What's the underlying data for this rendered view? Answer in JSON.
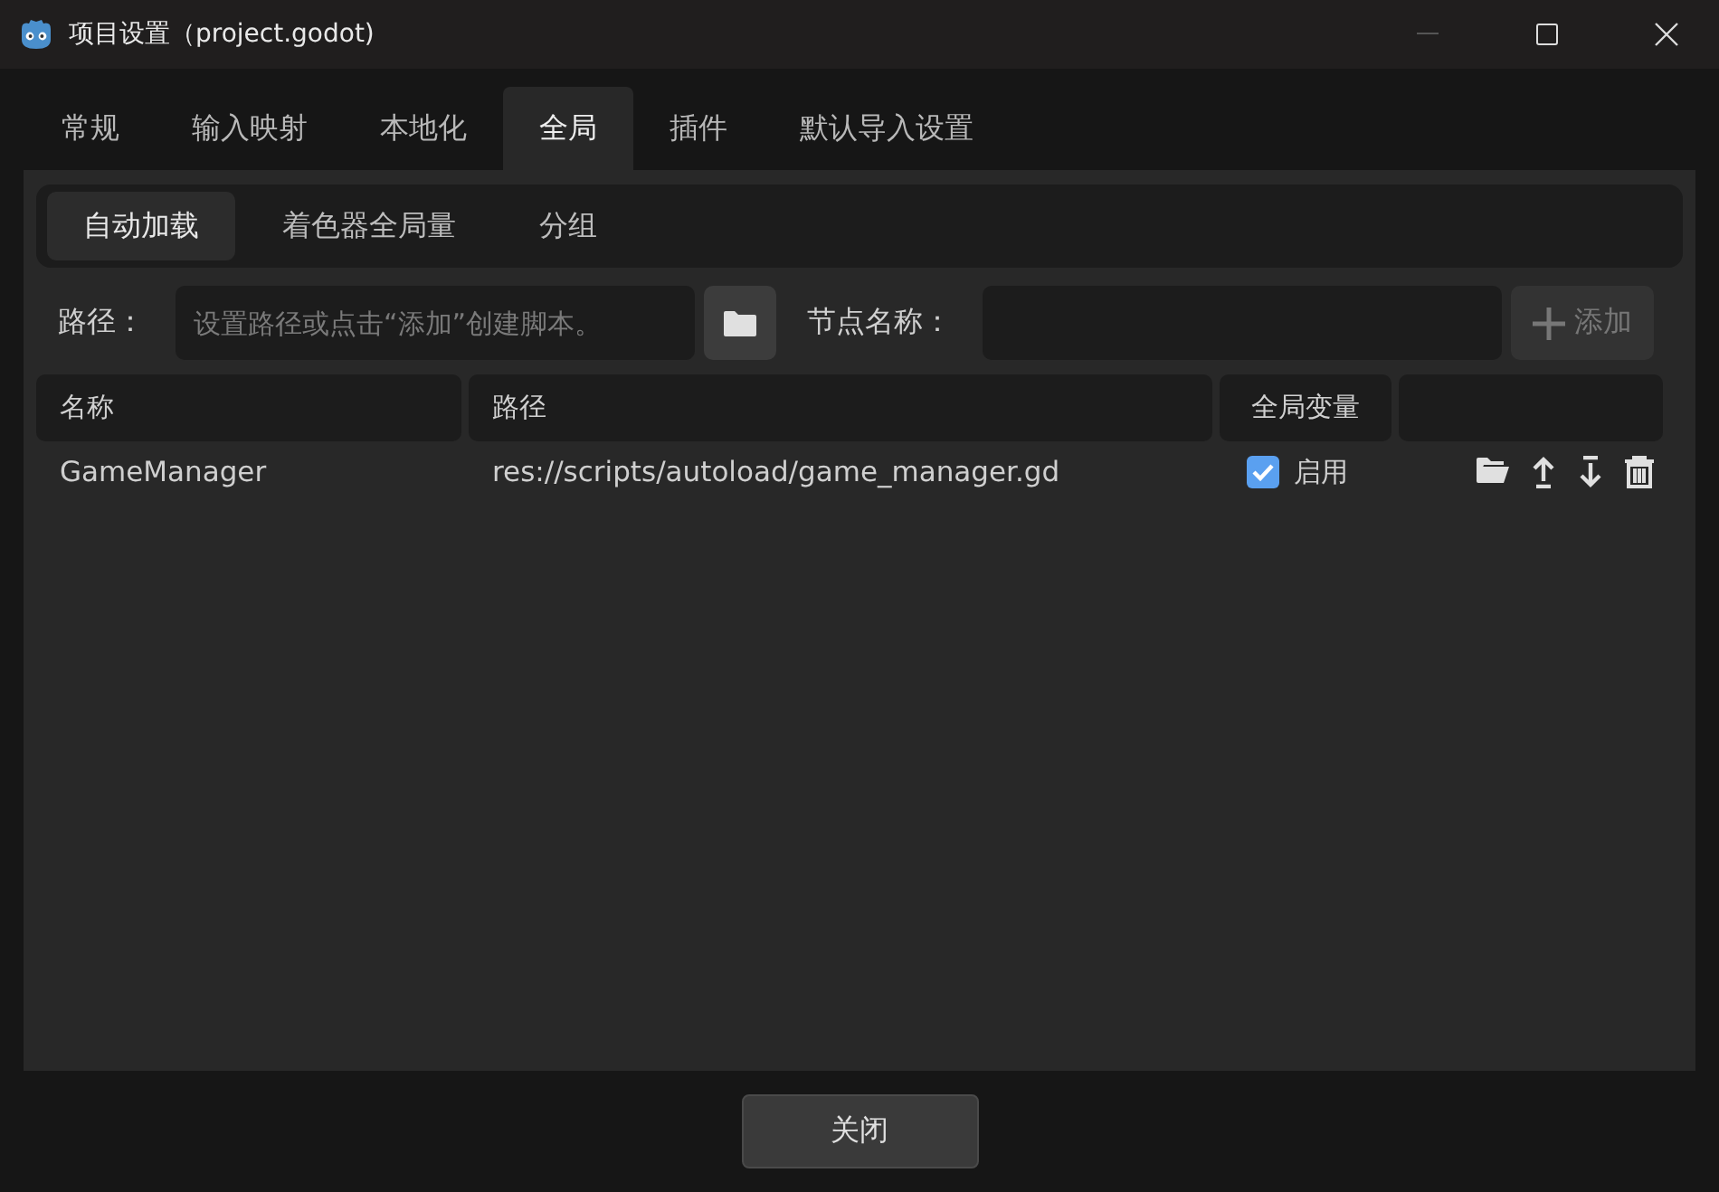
{
  "window": {
    "title": "项目设置（project.godot)"
  },
  "tabs": [
    {
      "label": "常规",
      "selected": false
    },
    {
      "label": "输入映射",
      "selected": false
    },
    {
      "label": "本地化",
      "selected": false
    },
    {
      "label": "全局",
      "selected": true
    },
    {
      "label": "插件",
      "selected": false
    },
    {
      "label": "默认导入设置",
      "selected": false
    }
  ],
  "subtabs": [
    {
      "label": "自动加载",
      "selected": true
    },
    {
      "label": "着色器全局量",
      "selected": false
    },
    {
      "label": "分组",
      "selected": false
    }
  ],
  "path_label": "路径：",
  "path_field": {
    "placeholder": "设置路径或点击“添加”创建脚本。"
  },
  "node_name_label": "节点名称：",
  "add_button": {
    "label": "添加",
    "disabled": true
  },
  "table": {
    "columns": [
      "名称",
      "路径",
      "全局变量",
      ""
    ],
    "rows": [
      {
        "name": "GameManager",
        "path": "res://scripts/autoload/game_manager.gd",
        "enabled": true,
        "enabled_label": "启用"
      }
    ]
  },
  "close_button": "关闭"
}
